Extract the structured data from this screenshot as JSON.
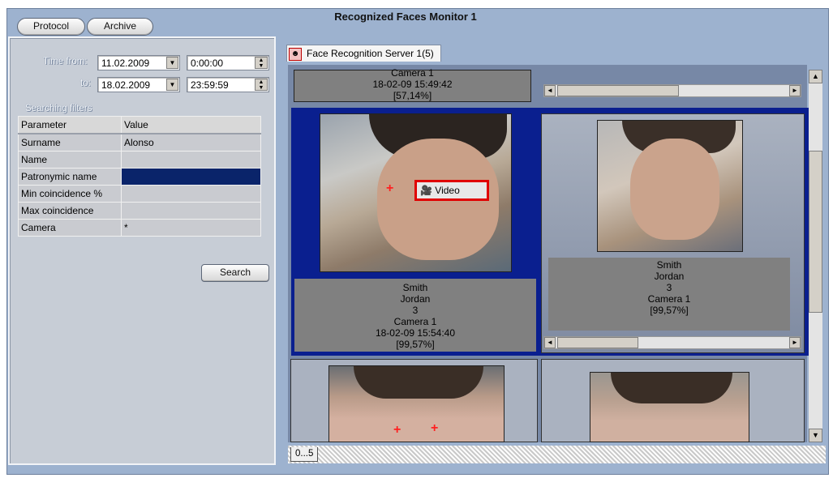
{
  "toolbar": {
    "protocol_label": "Protocol",
    "archive_label": "Archive"
  },
  "window": {
    "title": "Recognized Faces Monitor 1"
  },
  "filters": {
    "time_from_label": "Time from:",
    "to_label": "to:",
    "date_from": "11.02.2009",
    "time_from": "0:00:00",
    "date_to": "18.02.2009",
    "time_to": "23:59:59",
    "section_title": "Searching filters",
    "table_headers": [
      "Parameter",
      "Value"
    ],
    "rows": [
      {
        "param": "Surname",
        "value": "Alonso"
      },
      {
        "param": "Name",
        "value": ""
      },
      {
        "param": "Patronymic name",
        "value": ""
      },
      {
        "param": "Min coincidence %",
        "value": ""
      },
      {
        "param": "Max coincidence",
        "value": ""
      },
      {
        "param": "Camera",
        "value": "*"
      }
    ],
    "search_label": "Search"
  },
  "server_tab": {
    "label": "Face Recognition Server 1(5)"
  },
  "results": {
    "top_partial": {
      "line1": "Camera 1",
      "line2": "18-02-09 15:49:42",
      "line3": "[57,14%]"
    },
    "card_left": {
      "surname": "Smith",
      "name": "Jordan",
      "id": "3",
      "camera": "Camera 1",
      "timestamp": "18-02-09 15:54:40",
      "coincidence": "[99,57%]"
    },
    "card_right": {
      "surname": "Smith",
      "name": "Jordan",
      "id": "3",
      "camera": "Camera 1",
      "coincidence": "[99,57%]"
    },
    "video_button_label": "Video"
  },
  "pager": {
    "tab_label": "0...5"
  },
  "colors": {
    "selected_row": "#0a246a",
    "highlight_border": "#0a1f8f",
    "video_outline": "#e00000"
  }
}
